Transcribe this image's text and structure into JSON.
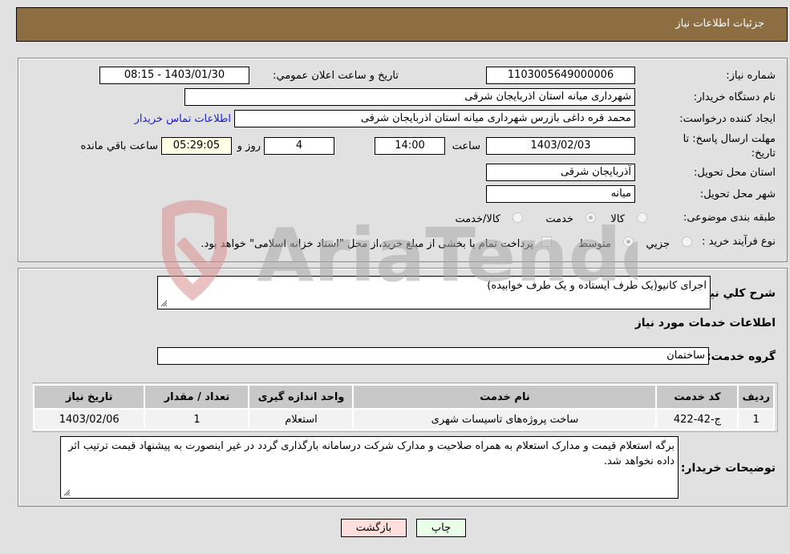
{
  "header": {
    "title": "جزئیات اطلاعات نیاز"
  },
  "details": {
    "need_number": {
      "label": "شماره نیاز:",
      "value": "1103005649000006"
    },
    "announce_datetime": {
      "label": "تاریخ و ساعت اعلان عمومي:",
      "value": "1403/01/30 - 08:15"
    },
    "buyer_org": {
      "label": "نام دستگاه خریدار:",
      "value": "شهرداری میانه استان اذربایجان شرقی"
    },
    "requester": {
      "label": "ایجاد کننده درخواست:",
      "value": "محمد قره داغی بازرس شهرداری میانه استان اذربایجان شرقی"
    },
    "contact_link": "اطلاعات تماس خریدار",
    "deadline": {
      "label": "مهلت ارسال پاسخ: تا تاریخ:",
      "date": "1403/02/03",
      "time_label": "ساعت",
      "time": "14:00",
      "days": "4",
      "days_label": "روز و",
      "remaining": "05:29:05",
      "remaining_label": "ساعت باقي مانده"
    },
    "delivery_province": {
      "label": "استان محل تحویل:",
      "value": "آذربایجان شرقی"
    },
    "delivery_city": {
      "label": "شهر محل تحویل:",
      "value": "میانه"
    },
    "category": {
      "label": "طبقه بندی موضوعی:",
      "options": [
        "کالا",
        "خدمت",
        "کالا/خدمت"
      ],
      "selected": "خدمت"
    },
    "process": {
      "label": "نوع فرآیند خرید :",
      "options": [
        "جزیي",
        "متوسط"
      ],
      "selected": "متوسط",
      "treasury_note": "پرداخت تمام یا بخشی از مبلغ خرید،از محل \"اسناد خزانه اسلامی\" خواهد بود.",
      "treasury_checked": false
    }
  },
  "summary": {
    "label": "شرح کلي نیاز:",
    "value": "اجرای کانیو(یک طرف ایستاده و یک طرف خوابیده)",
    "services_title": "اطلاعات خدمات مورد نیاز",
    "service_group_label": "گروه خدمت:",
    "service_group": "ساختمان"
  },
  "table": {
    "headers": [
      "ردیف",
      "کد خدمت",
      "نام خدمت",
      "واحد اندازه گیری",
      "تعداد / مقدار",
      "تاریخ نیاز"
    ],
    "rows": [
      [
        "1",
        "ج-42-422",
        "ساخت پروژه‌های تاسیسات شهری",
        "استعلام",
        "1",
        "1403/02/06"
      ]
    ]
  },
  "buyer_notes": {
    "label": "توضیحات خریدار:",
    "value": "برگه استعلام قیمت و مدارک استعلام به همراه صلاحیت و مدارک شرکت درسامانه بارگذاری گردد در غیر اینصورت به پیشنهاد قیمت ترتیب اثر داده نخواهد شد."
  },
  "buttons": {
    "print": "چاپ",
    "back": "بازگشت"
  },
  "watermark": {
    "text": "AriaTender.neT"
  },
  "colors": {
    "header_bg": "#8d6e43",
    "print_bg": "#eaffea",
    "back_bg": "#ffdede",
    "remaining_bg": "#ffffe6",
    "link": "#1a1adb"
  }
}
